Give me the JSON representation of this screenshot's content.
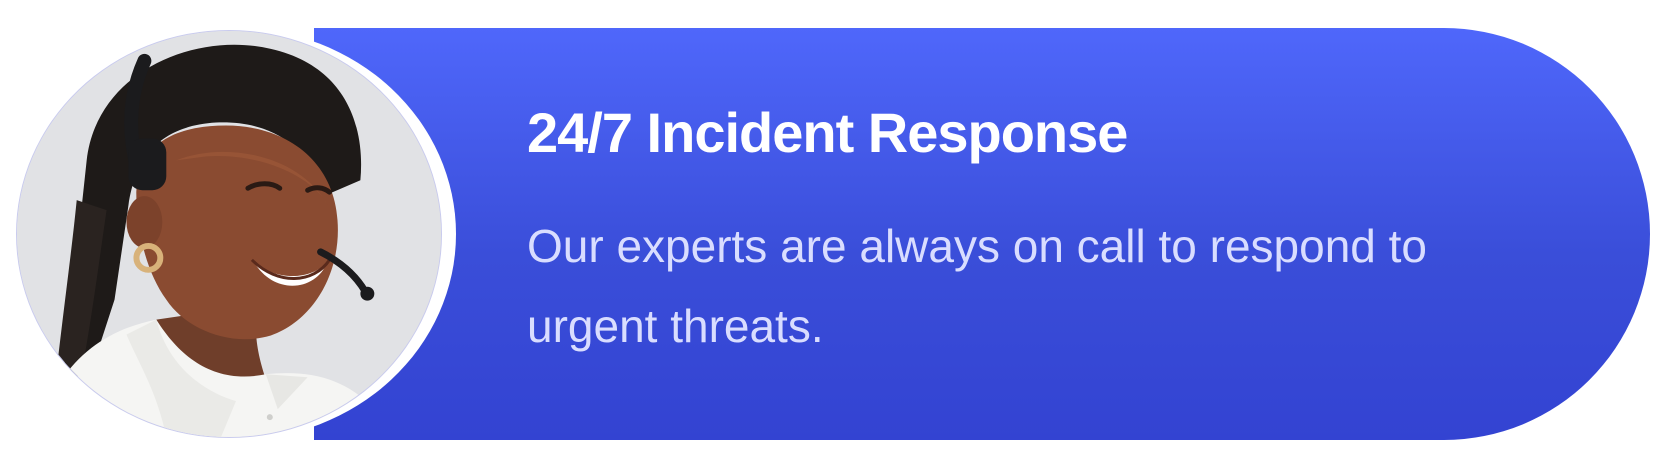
{
  "card": {
    "title": "24/7 Incident Response",
    "description": "Our experts are always on call to respond to urgent threats.",
    "image_subject": "smiling support agent wearing a headset"
  },
  "colors": {
    "gradient_top": "#4f67fb",
    "gradient_bottom": "#3343d2",
    "title_text": "#ffffff",
    "body_text": "#d9ddff",
    "page_background": "#ffffff"
  }
}
